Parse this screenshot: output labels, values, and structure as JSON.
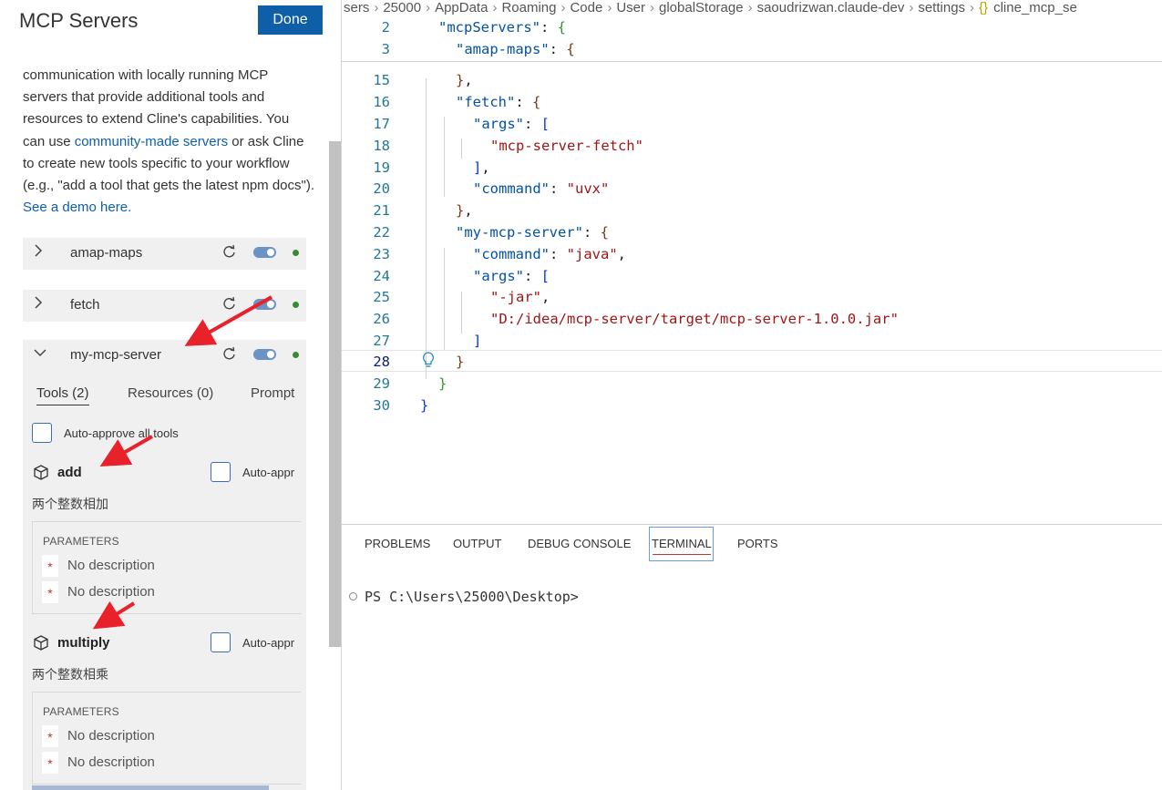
{
  "left_panel": {
    "title": "MCP Servers",
    "done_label": "Done",
    "description": {
      "text1": "communication with locally running MCP servers that provide additional tools and resources to extend Cline's capabilities. You can use ",
      "link1": "community-made servers",
      "text2": " or ask Cline to create new tools specific to your workflow (e.g., \"add a tool that gets the latest npm docs\"). ",
      "link2": "See a demo here."
    },
    "servers": [
      {
        "name": "amap-maps",
        "chevron": "chevron-right-icon",
        "status_color": "#388a34"
      },
      {
        "name": "fetch",
        "chevron": "chevron-right-icon",
        "status_color": "#388a34"
      },
      {
        "name": "my-mcp-server",
        "chevron": "chevron-down-icon",
        "status_color": "#388a34"
      }
    ],
    "expanded_server": {
      "tabs": [
        "Tools (2)",
        "Resources (0)",
        "Prompt"
      ],
      "auto_approve_all": "Auto-approve all tools",
      "tools": [
        {
          "name": "add",
          "auto_approve": "Auto-appr",
          "description": "两个整数相加",
          "params_header": "PARAMETERS",
          "params": [
            {
              "required": "*",
              "description": "No description"
            },
            {
              "required": "*",
              "description": "No description"
            }
          ]
        },
        {
          "name": "multiply",
          "auto_approve": "Auto-appr",
          "description": "两个整数相乘",
          "params_header": "PARAMETERS",
          "params": [
            {
              "required": "*",
              "description": "No description"
            },
            {
              "required": "*",
              "description": "No description"
            }
          ]
        }
      ]
    }
  },
  "editor": {
    "breadcrumbs": [
      "sers",
      "25000",
      "AppData",
      "Roaming",
      "Code",
      "User",
      "globalStorage",
      "saoudrizwan.claude-dev",
      "settings",
      "cline_mcp_se"
    ],
    "breadcrumb_file_icon": "{}",
    "sticky_lines": [
      {
        "num": "2",
        "text": "\"mcpServers\": {"
      },
      {
        "num": "3",
        "text": "\"amap-maps\": {"
      }
    ],
    "lines": [
      {
        "num": "15"
      },
      {
        "num": "16"
      },
      {
        "num": "17"
      },
      {
        "num": "18"
      },
      {
        "num": "19"
      },
      {
        "num": "20"
      },
      {
        "num": "21"
      },
      {
        "num": "22"
      },
      {
        "num": "23"
      },
      {
        "num": "24"
      },
      {
        "num": "25"
      },
      {
        "num": "26"
      },
      {
        "num": "27"
      },
      {
        "num": "28"
      },
      {
        "num": "29"
      },
      {
        "num": "30"
      }
    ],
    "code_strings": {
      "fetch_key": "\"fetch\"",
      "args_key": "\"args\"",
      "fetch_arg": "\"mcp-server-fetch\"",
      "command_key": "\"command\"",
      "uvx": "\"uvx\"",
      "my_server_key": "\"my-mcp-server\"",
      "java": "\"java\"",
      "jar_flag": "\"-jar\"",
      "jar_path": "\"D:/idea/mcp-server/target/mcp-server-1.0.0.jar\""
    }
  },
  "panel": {
    "tabs": [
      "PROBLEMS",
      "OUTPUT",
      "DEBUG CONSOLE",
      "TERMINAL",
      "PORTS"
    ],
    "active_tab": "TERMINAL",
    "terminal_prompt": "PS C:\\Users\\25000\\Desktop>"
  },
  "colors": {
    "accent": "#0e5fa8",
    "annotation_arrow": "#e8212a",
    "status_running": "#388a34"
  }
}
